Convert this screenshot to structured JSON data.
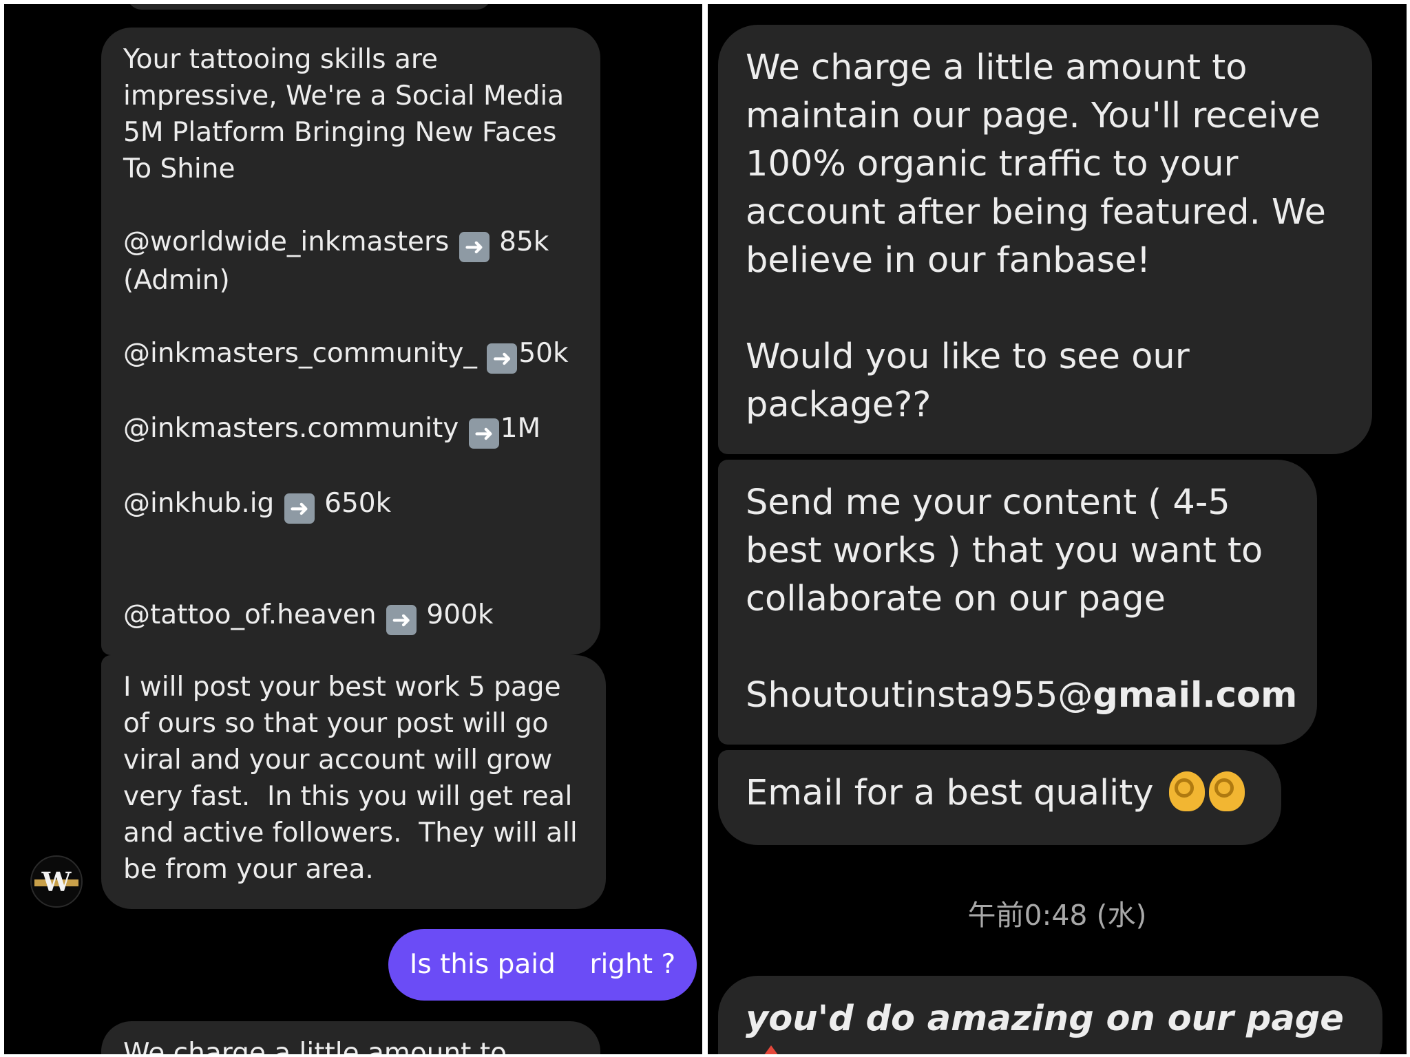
{
  "left_panel": {
    "messages": [
      {
        "text": "Your tattooing skills are\nimpressive, We're a Social Media\n5M Platform Bringing New Faces\nTo Shine",
        "accounts": [
          {
            "handle": "@worldwide_inkmasters",
            "count": "85k",
            "extra": "(Admin)"
          },
          {
            "handle": "@inkmasters_community_",
            "count": "50k"
          },
          {
            "handle": "@inkmasters.community",
            "count": "1M"
          },
          {
            "handle": "@inkhub.ig",
            "count": "650k"
          },
          {
            "handle": "@tattoo_of.heaven",
            "count": "900k"
          }
        ]
      },
      {
        "text": "I will post your best work 5 page\nof ours so that your post will go\nviral and your account will grow\nvery fast.  In this you will get real\nand active followers.  They will all\nbe from your area."
      },
      {
        "text": "We charge a little amount to"
      }
    ],
    "sent_message": "Is this paid    right ?",
    "avatar_letter": "W",
    "arrow_icon": "right-arrow-emoji"
  },
  "right_panel": {
    "messages": [
      {
        "text": "We charge a little amount to\nmaintain our page. You'll receive\n100% organic traffic to your\naccount after being featured. We\nbelieve in our fanbase!\n\nWould you like to see our\npackage??"
      },
      {
        "text_head": "Send me your content ( 4-5\nbest works ) that you want to\ncollaborate on our page\n\nShoutoutinsta955@",
        "text_tail": "gmail.com"
      },
      {
        "text": "Email for a best quality",
        "emoji": "ok-hand-emoji-x2"
      },
      {
        "text": "you'd do amazing on our page",
        "emoji": "outbox-tray-emoji"
      }
    ],
    "timestamp": "午前0:48 (水)"
  },
  "colors": {
    "background": "#000000",
    "bubble_received": "#262626",
    "bubble_sent": "#6b4cf6",
    "text": "#ededed",
    "timestamp": "#a8a8a8"
  }
}
